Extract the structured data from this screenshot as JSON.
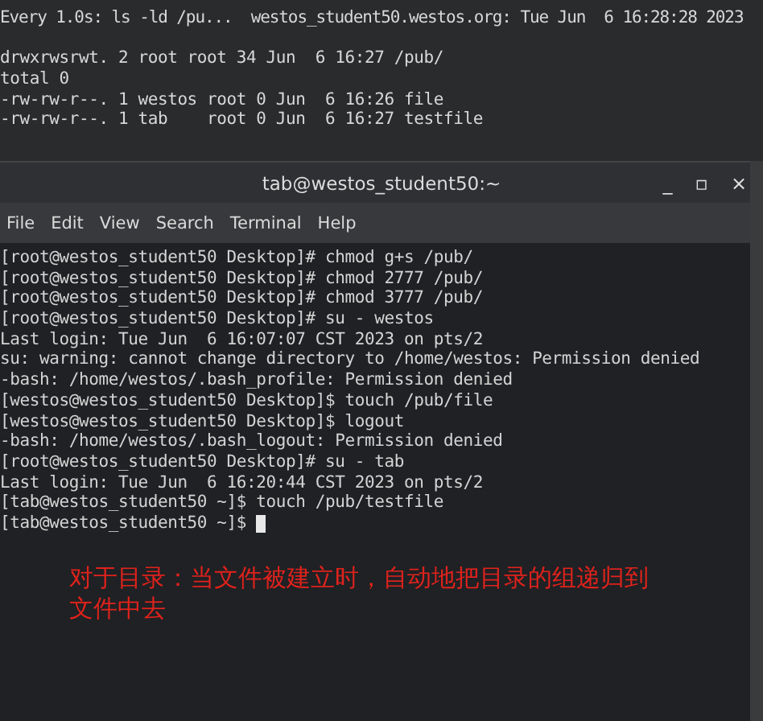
{
  "background_terminal": {
    "lines": [
      "Every 1.0s: ls -ld /pu...  westos_student50.westos.org: Tue Jun  6 16:28:28 2023",
      "drwxrwsrwt. 2 root root 34 Jun  6 16:27 /pub/",
      "total 0",
      "-rw-rw-r--. 1 westos root 0 Jun  6 16:26 file",
      "-rw-rw-r--. 1 tab    root 0 Jun  6 16:27 testfile"
    ]
  },
  "window": {
    "title": "tab@westos_student50:~",
    "controls": [
      "_",
      "▫",
      "×"
    ]
  },
  "menu": [
    "File",
    "Edit",
    "View",
    "Search",
    "Terminal",
    "Help"
  ],
  "terminal": {
    "lines": [
      "[root@westos_student50 Desktop]# chmod g+s /pub/",
      "[root@westos_student50 Desktop]# chmod 2777 /pub/",
      "[root@westos_student50 Desktop]# chmod 3777 /pub/",
      "[root@westos_student50 Desktop]# su - westos",
      "Last login: Tue Jun  6 16:07:07 CST 2023 on pts/2",
      "su: warning: cannot change directory to /home/westos: Permission denied",
      "-bash: /home/westos/.bash_profile: Permission denied",
      "[westos@westos_student50 Desktop]$ touch /pub/file",
      "[westos@westos_student50 Desktop]$ logout",
      "-bash: /home/westos/.bash_logout: Permission denied",
      "[root@westos_student50 Desktop]# su - tab",
      "Last login: Tue Jun  6 16:20:44 CST 2023 on pts/2",
      "[tab@westos_student50 ~]$ touch /pub/testfile",
      "[tab@westos_student50 ~]$ "
    ],
    "cursor": true
  },
  "annotation": "对于目录：当文件被建立时，自动地把目录的组递归到文件中去"
}
